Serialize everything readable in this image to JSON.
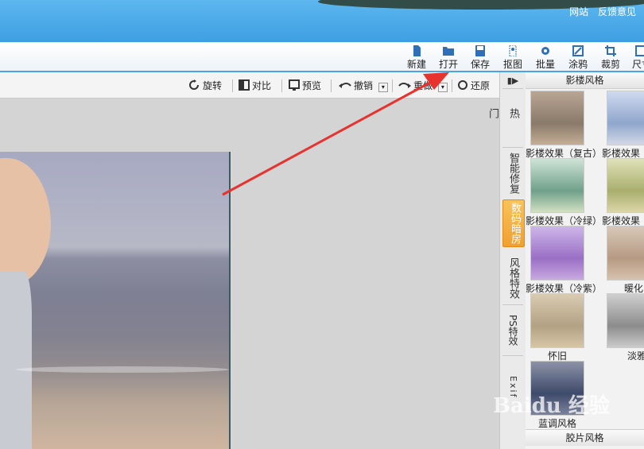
{
  "titlebar": {
    "links": [
      "网站",
      "反馈意见"
    ]
  },
  "toolbar": {
    "items": [
      {
        "label": "新建",
        "icon": "new-file-icon"
      },
      {
        "label": "打开",
        "icon": "open-folder-icon"
      },
      {
        "label": "保存",
        "icon": "save-disk-icon"
      },
      {
        "label": "抠图",
        "icon": "cutout-icon"
      },
      {
        "label": "批量",
        "icon": "batch-gear-icon"
      },
      {
        "label": "涂鸦",
        "icon": "doodle-icon"
      },
      {
        "label": "裁剪",
        "icon": "crop-icon"
      },
      {
        "label": "尺寸",
        "icon": "resize-icon"
      }
    ]
  },
  "subbar": {
    "rotate": "旋转",
    "compare": "对比",
    "preview": "预览",
    "undo": "撤销",
    "redo": "重做",
    "restore": "还原"
  },
  "side_tabs": {
    "collapse_icon": "▮▶",
    "hot": "热门",
    "smart_repair": "智能修复",
    "digital_darkroom": "数码暗房",
    "style_effects": "风格特效",
    "ps_effects": "PS特效",
    "exif": "Exif"
  },
  "panel": {
    "section_title": "影楼风格",
    "footer_title": "胶片风格",
    "thumbs": [
      {
        "caption": "影楼效果（复古）",
        "tint": "#8a7a6a"
      },
      {
        "caption": "影楼效果",
        "tint": "#8fa6cc"
      },
      {
        "caption": "影楼效果（冷绿）",
        "tint": "#6fa08a"
      },
      {
        "caption": "影楼效果",
        "tint": "#a9ae6e"
      },
      {
        "caption": "影楼效果（冷紫）",
        "tint": "#9a6fc4"
      },
      {
        "caption": "暖化",
        "tint": "#b79a84"
      },
      {
        "caption": "怀旧",
        "tint": "#b3a183"
      },
      {
        "caption": "淡雅",
        "tint": "#8c8c8c"
      },
      {
        "caption": "蓝调风格",
        "tint": "#3e4a6a"
      }
    ]
  },
  "watermark": "Baidu 经验"
}
